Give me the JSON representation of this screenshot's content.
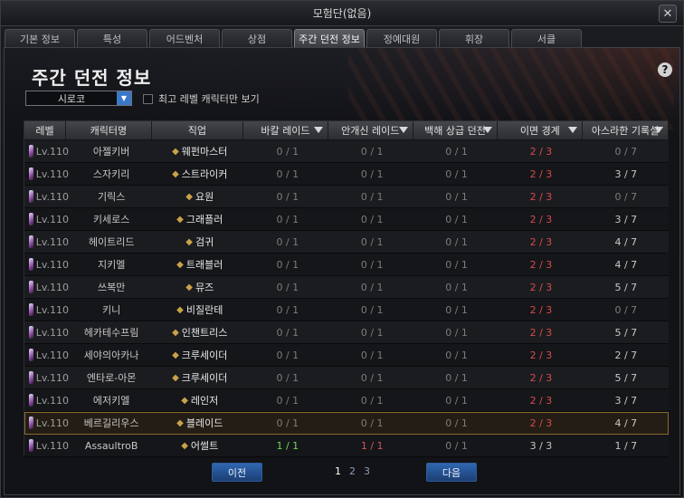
{
  "window": {
    "title": "모험단(없음)",
    "close_label": "✕"
  },
  "tabs": [
    "기본 정보",
    "특성",
    "어드벤처",
    "상점",
    "주간 던전 정보",
    "정예대원",
    "휘장",
    "서클"
  ],
  "active_tab_index": 4,
  "heading": "주간 던전 정보",
  "help_label": "?",
  "server": {
    "value": "시로코"
  },
  "filter": {
    "label": "최고 레벨 캐릭터만 보기",
    "checked": false
  },
  "columns": [
    "레벨",
    "캐릭터명",
    "직업",
    "바칼 레이드",
    "안개신 레이드",
    "백해 상급 던전",
    "이면 경계",
    "아스라한 기록실"
  ],
  "rows": [
    {
      "level": "Lv.110",
      "name": "아젤키버",
      "job": "웨펀마스터",
      "r1": "0 / 1",
      "r2": "0 / 1",
      "r3": "0 / 1",
      "r4": "2 / 3",
      "r5": "0 / 7"
    },
    {
      "level": "Lv.110",
      "name": "스자키리",
      "job": "스트라이커",
      "r1": "0 / 1",
      "r2": "0 / 1",
      "r3": "0 / 1",
      "r4": "2 / 3",
      "r5": "3 / 7"
    },
    {
      "level": "Lv.110",
      "name": "기릭스",
      "job": "요원",
      "r1": "0 / 1",
      "r2": "0 / 1",
      "r3": "0 / 1",
      "r4": "2 / 3",
      "r5": "0 / 7"
    },
    {
      "level": "Lv.110",
      "name": "키세로스",
      "job": "그래플러",
      "r1": "0 / 1",
      "r2": "0 / 1",
      "r3": "0 / 1",
      "r4": "2 / 3",
      "r5": "3 / 7"
    },
    {
      "level": "Lv.110",
      "name": "헤이트리드",
      "job": "검귀",
      "r1": "0 / 1",
      "r2": "0 / 1",
      "r3": "0 / 1",
      "r4": "2 / 3",
      "r5": "4 / 7"
    },
    {
      "level": "Lv.110",
      "name": "지키멜",
      "job": "트래블러",
      "r1": "0 / 1",
      "r2": "0 / 1",
      "r3": "0 / 1",
      "r4": "2 / 3",
      "r5": "4 / 7"
    },
    {
      "level": "Lv.110",
      "name": "쓰복만",
      "job": "뮤즈",
      "r1": "0 / 1",
      "r2": "0 / 1",
      "r3": "0 / 1",
      "r4": "2 / 3",
      "r5": "5 / 7"
    },
    {
      "level": "Lv.110",
      "name": "키니",
      "job": "비질란테",
      "r1": "0 / 1",
      "r2": "0 / 1",
      "r3": "0 / 1",
      "r4": "2 / 3",
      "r5": "0 / 7"
    },
    {
      "level": "Lv.110",
      "name": "헤카테수프림",
      "job": "인챈트리스",
      "r1": "0 / 1",
      "r2": "0 / 1",
      "r3": "0 / 1",
      "r4": "2 / 3",
      "r5": "5 / 7"
    },
    {
      "level": "Lv.110",
      "name": "세야의아카나",
      "job": "크루세이더",
      "r1": "0 / 1",
      "r2": "0 / 1",
      "r3": "0 / 1",
      "r4": "2 / 3",
      "r5": "2 / 7"
    },
    {
      "level": "Lv.110",
      "name": "엔타로-아몬",
      "job": "크루세이더",
      "r1": "0 / 1",
      "r2": "0 / 1",
      "r3": "0 / 1",
      "r4": "2 / 3",
      "r5": "5 / 7"
    },
    {
      "level": "Lv.110",
      "name": "에저키엘",
      "job": "레인저",
      "r1": "0 / 1",
      "r2": "0 / 1",
      "r3": "0 / 1",
      "r4": "2 / 3",
      "r5": "3 / 7"
    },
    {
      "level": "Lv.110",
      "name": "베르길리우스",
      "job": "블레이드",
      "r1": "0 / 1",
      "r2": "0 / 1",
      "r3": "0 / 1",
      "r4": "2 / 3",
      "r5": "4 / 7",
      "selected": true
    },
    {
      "level": "Lv.110",
      "name": "AssaultroB",
      "job": "어썰트",
      "r1": "1 / 1",
      "r2": "1 / 1",
      "r3": "0 / 1",
      "r4": "3 / 3",
      "r5": "1 / 7"
    }
  ],
  "pagination": {
    "prev_label": "이전",
    "next_label": "다음",
    "pages": [
      "1",
      "2",
      "3"
    ],
    "current_page": "1"
  },
  "colors": {
    "accent_blue": "#2f66b0",
    "cleared_red": "#d84a4a",
    "complete_green": "#6fd85a",
    "selected_border": "#8a6a2c"
  }
}
